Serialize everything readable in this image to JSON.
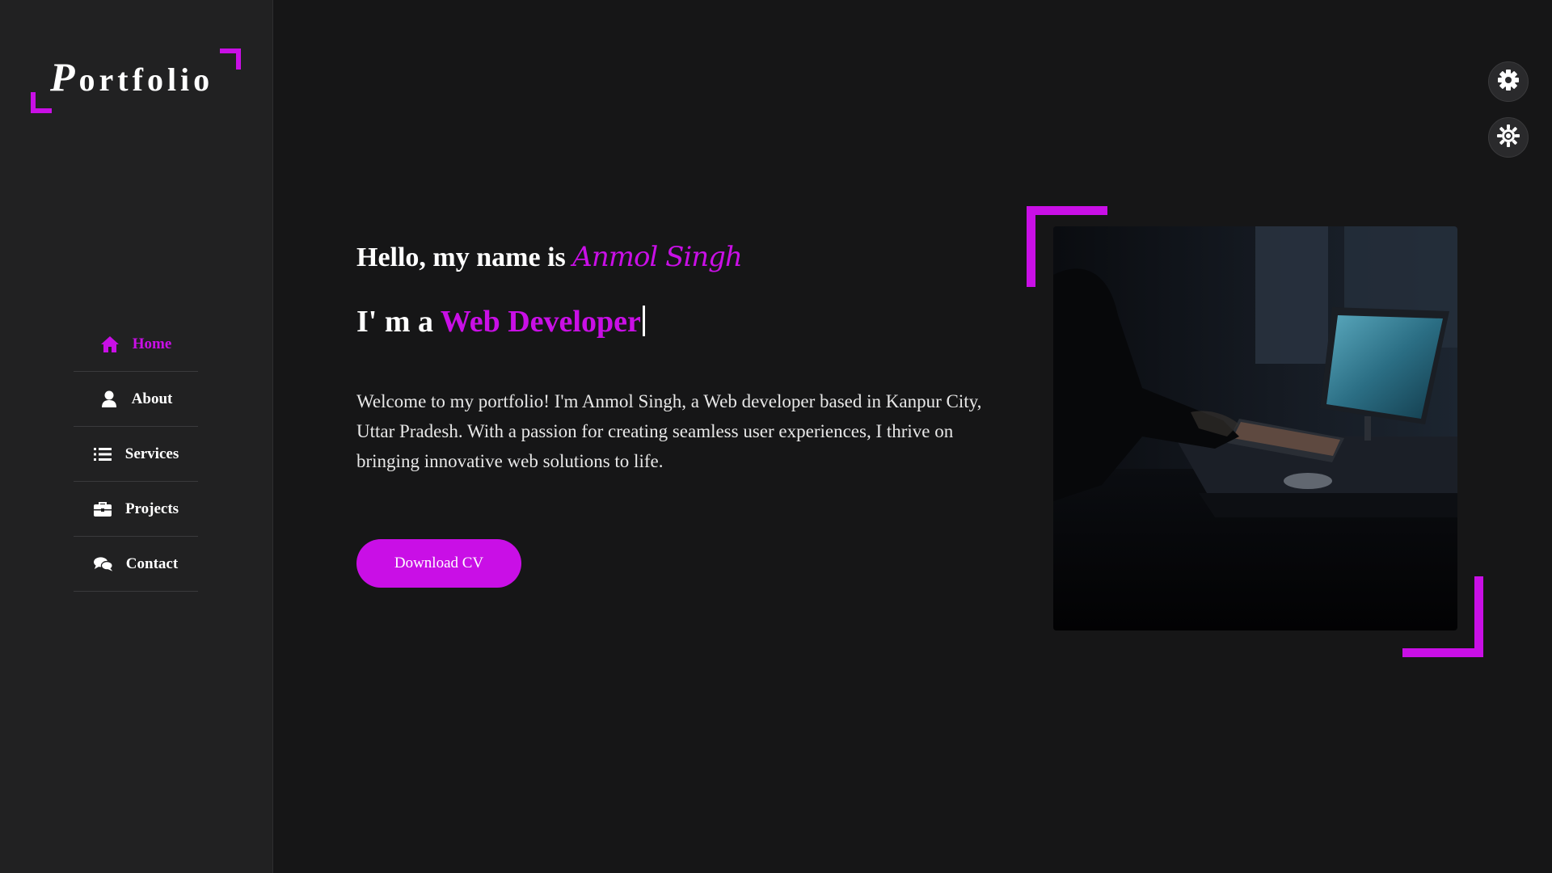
{
  "logo": {
    "first_letter": "P",
    "rest": "ortfolio"
  },
  "nav": {
    "items": [
      {
        "label": "Home",
        "icon": "home-icon",
        "active": true
      },
      {
        "label": "About",
        "icon": "user-icon",
        "active": false
      },
      {
        "label": "Services",
        "icon": "list-icon",
        "active": false
      },
      {
        "label": "Projects",
        "icon": "briefcase-icon",
        "active": false
      },
      {
        "label": "Contact",
        "icon": "comments-icon",
        "active": false
      }
    ]
  },
  "hero": {
    "greeting": "Hello, my name is",
    "name": "Anmol Singh",
    "role_prefix": "I' m a",
    "role": "Web Developer",
    "intro": "Welcome to my portfolio! I'm Anmol Singh, a Web developer based in Kanpur City, Uttar Pradesh. With a passion for creating seamless user experiences, I thrive on bringing innovative web solutions to life.",
    "cta_label": "Download CV"
  },
  "settings": {
    "top_icon": "gear-icon",
    "bottom_icon": "sun-gear-icon"
  },
  "colors": {
    "accent": "#c90fe6",
    "sidebar_bg": "#212122",
    "page_bg": "#161617"
  }
}
